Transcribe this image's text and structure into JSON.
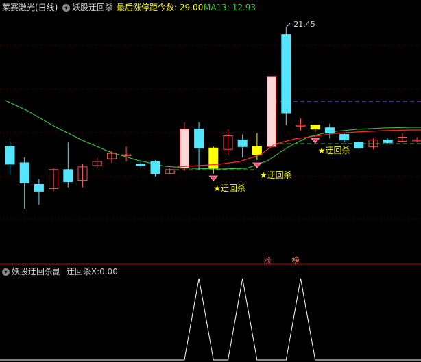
{
  "top_header": {
    "stock_label": "莱赛激光(日线)",
    "indicator_name": "妖股迂回杀",
    "limit_label": "最后涨停距今数:",
    "limit_value": "29.00",
    "ma_label": "MA13:",
    "ma_value": "12.93"
  },
  "sub_header": {
    "indicator_name": "妖股迂回杀副",
    "series_label": "迂回杀X:",
    "series_value": "0.00"
  },
  "colors": {
    "background": "#000000",
    "up_candle": "#ff5555",
    "up_candle_fill": "#ffd7d7",
    "down_candle": "#55e6ff",
    "highlight_candle": "#ffff00",
    "ma13_line": "#ff2a2a",
    "long_ma_line": "#3cd43c",
    "dashed_green": "#3cb43c",
    "dashed_purple": "#9c4bff",
    "signal_text": "#ffff00",
    "grid": "#7a0000",
    "separator": "#c00000",
    "subchart_line": "#ffffff"
  },
  "chart_data": [
    {
      "type": "candlestick",
      "title": "莱赛激光(日线)",
      "indicator": "妖股迂回杀",
      "annotation_max": "21.45",
      "series": [
        {
          "name": "MA13",
          "values_note": "red moving-average line",
          "last_value": 12.93
        }
      ],
      "signals": [
        {
          "label": "★迂回杀",
          "bar_index": 14
        },
        {
          "label": "★迂回杀",
          "bar_index": 17
        },
        {
          "label": "★迂回杀",
          "bar_index": 21
        }
      ],
      "bottom_badges": [
        "涨",
        "榜"
      ],
      "candles": [
        {
          "o": 12.6,
          "c": 11.3,
          "h": 13.0,
          "l": 10.5,
          "dir": "down"
        },
        {
          "o": 11.4,
          "c": 9.9,
          "h": 11.8,
          "l": 8.0,
          "dir": "down"
        },
        {
          "o": 9.8,
          "c": 9.3,
          "h": 10.2,
          "l": 8.3,
          "dir": "down"
        },
        {
          "o": 9.5,
          "c": 10.9,
          "h": 11.0,
          "l": 9.3,
          "dir": "up"
        },
        {
          "o": 10.9,
          "c": 10.0,
          "h": 12.9,
          "l": 9.6,
          "dir": "down"
        },
        {
          "o": 10.1,
          "c": 11.1,
          "h": 11.3,
          "l": 9.6,
          "dir": "up"
        },
        {
          "o": 11.2,
          "c": 11.5,
          "h": 11.8,
          "l": 11.0,
          "dir": "up"
        },
        {
          "o": 11.7,
          "c": 12.1,
          "h": 12.3,
          "l": 11.4,
          "dir": "up"
        },
        {
          "o": 12.0,
          "c": 12.0,
          "h": 12.6,
          "l": 11.5,
          "dir": "flat"
        },
        {
          "o": 11.3,
          "c": 11.2,
          "h": 11.5,
          "l": 11.0,
          "dir": "down"
        },
        {
          "o": 11.5,
          "c": 10.6,
          "h": 11.6,
          "l": 10.4,
          "dir": "down"
        },
        {
          "o": 10.6,
          "c": 10.9,
          "h": 11.0,
          "l": 10.6,
          "dir": "up"
        },
        {
          "o": 11.0,
          "c": 13.9,
          "h": 14.4,
          "l": 10.8,
          "dir": "up"
        },
        {
          "o": 13.9,
          "c": 12.5,
          "h": 14.4,
          "l": 10.9,
          "dir": "down"
        },
        {
          "o": 11.0,
          "c": 12.5,
          "h": 12.6,
          "l": 10.6,
          "dir": "hl"
        },
        {
          "o": 12.4,
          "c": 13.4,
          "h": 13.9,
          "l": 12.0,
          "dir": "up"
        },
        {
          "o": 13.1,
          "c": 12.6,
          "h": 13.5,
          "l": 11.8,
          "dir": "down"
        },
        {
          "o": 12.0,
          "c": 12.6,
          "h": 13.6,
          "l": 11.6,
          "dir": "hl"
        },
        {
          "o": 12.6,
          "c": 17.8,
          "h": 17.8,
          "l": 12.6,
          "dir": "up"
        },
        {
          "o": 20.9,
          "c": 15.1,
          "h": 21.45,
          "l": 14.2,
          "dir": "down"
        },
        {
          "o": 14.2,
          "c": 14.2,
          "h": 14.7,
          "l": 13.8,
          "dir": "flat"
        },
        {
          "o": 14.2,
          "c": 13.9,
          "h": 14.2,
          "l": 13.7,
          "dir": "hl"
        },
        {
          "o": 14.0,
          "c": 13.6,
          "h": 14.3,
          "l": 13.2,
          "dir": "down"
        },
        {
          "o": 13.5,
          "c": 13.1,
          "h": 13.6,
          "l": 12.9,
          "dir": "down"
        },
        {
          "o": 12.9,
          "c": 12.5,
          "h": 13.0,
          "l": 12.4,
          "dir": "down"
        },
        {
          "o": 12.6,
          "c": 13.1,
          "h": 13.2,
          "l": 12.4,
          "dir": "up"
        },
        {
          "o": 13.1,
          "c": 12.9,
          "h": 13.2,
          "l": 12.8,
          "dir": "down"
        },
        {
          "o": 13.0,
          "c": 13.3,
          "h": 13.6,
          "l": 12.9,
          "dir": "up"
        },
        {
          "o": 13.1,
          "c": 13.1,
          "h": 13.3,
          "l": 12.9,
          "dir": "flat"
        }
      ],
      "ylim": [
        8.0,
        22.2
      ]
    },
    {
      "type": "line",
      "title": "妖股迂回杀副",
      "series": [
        {
          "name": "迂回杀X",
          "values": [
            0,
            0,
            0,
            0,
            0,
            0,
            0,
            0,
            0,
            0,
            0,
            0,
            0,
            1,
            0,
            0,
            1,
            0,
            0,
            0,
            1,
            0,
            0,
            0,
            0,
            0,
            0,
            0,
            0
          ]
        }
      ],
      "last_value": 0.0,
      "ylim": [
        0,
        1
      ]
    }
  ]
}
